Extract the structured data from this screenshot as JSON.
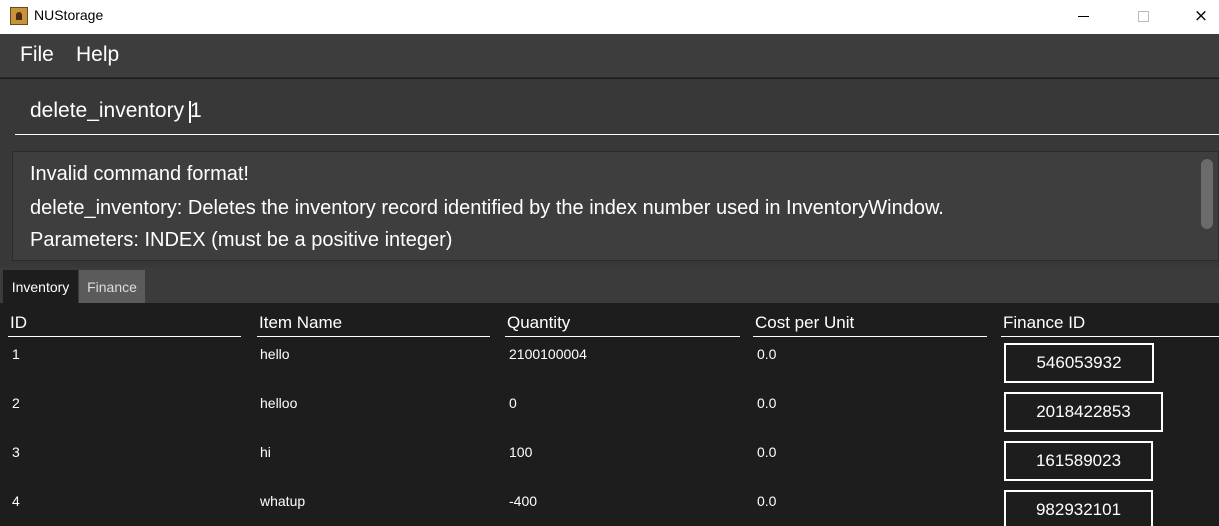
{
  "window": {
    "title": "NUStorage",
    "controls": {
      "minimize": "minimize-icon",
      "maximize": "maximize-icon",
      "close": "×"
    }
  },
  "menu": {
    "items": [
      "File",
      "Help"
    ]
  },
  "command_box": {
    "value": "delete_inventory 1"
  },
  "result_display": {
    "lines": [
      "Invalid command format!",
      "delete_inventory: Deletes the inventory record identified by the index number used in InventoryWindow.",
      "Parameters: INDEX (must be a positive integer)"
    ]
  },
  "tabs": [
    {
      "label": "Inventory",
      "selected": true
    },
    {
      "label": "Finance",
      "selected": false
    }
  ],
  "table": {
    "headers": [
      "ID",
      "Item Name",
      "Quantity",
      "Cost per Unit",
      "Finance ID"
    ],
    "rows": [
      {
        "id": "1",
        "name": "hello",
        "quantity": "2100100004",
        "cost": "0.0",
        "finance_id": "546053932"
      },
      {
        "id": "2",
        "name": "helloo",
        "quantity": "0",
        "cost": "0.0",
        "finance_id": "2018422853"
      },
      {
        "id": "3",
        "name": "hi",
        "quantity": "100",
        "cost": "0.0",
        "finance_id": "161589023"
      },
      {
        "id": "4",
        "name": "whatup",
        "quantity": "-400",
        "cost": "0.0",
        "finance_id": "982932101"
      }
    ]
  },
  "colors": {
    "background": "#1d1d1d",
    "panel": "#383838",
    "menubar": "#3d3d3d",
    "text": "#ffffff"
  }
}
